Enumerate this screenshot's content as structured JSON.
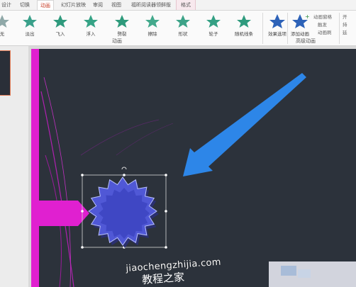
{
  "tabs": [
    "设计",
    "切换",
    "动画",
    "幻灯片放映",
    "审阅",
    "视图",
    "福昕阅读器领鲜版",
    "格式"
  ],
  "active_tab": "动画",
  "animations": [
    {
      "label": "无",
      "icon": "star-icon"
    },
    {
      "label": "淡出",
      "icon": "star-icon"
    },
    {
      "label": "飞入",
      "icon": "star-icon"
    },
    {
      "label": "浮入",
      "icon": "star-icon"
    },
    {
      "label": "劈裂",
      "icon": "star-icon"
    },
    {
      "label": "擦除",
      "icon": "star-icon"
    },
    {
      "label": "形状",
      "icon": "star-icon"
    },
    {
      "label": "轮子",
      "icon": "star-icon"
    },
    {
      "label": "随机线条",
      "icon": "star-icon"
    }
  ],
  "effect_options": "效果选项",
  "group_animation": "动画",
  "add_animation": "添加动画",
  "animation_pane": "动画窗格",
  "trigger": "触发",
  "animation_painter": "动画刷",
  "group_advanced": "高级动画",
  "start": "开",
  "duration": "持",
  "delay": "延",
  "watermark_url": "jiaochengzhijia.com",
  "watermark_cn": "教程之家",
  "colors": {
    "accent_tab": "#c8402a",
    "slide_bg": "#2c323b",
    "magenta": "#e020d0",
    "arrow": "#2d86e8",
    "star": "#5060d8"
  }
}
